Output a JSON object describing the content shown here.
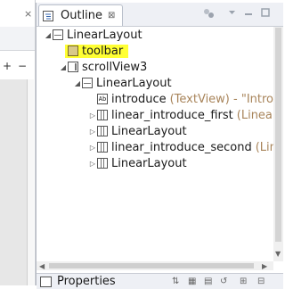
{
  "left_panel": {
    "tab_close": "×",
    "zoom_in": "+",
    "zoom_out": "−"
  },
  "outline": {
    "tab_title": "Outline",
    "tab_close": "⊠",
    "toolbar_icons": [
      "tree-options-icon",
      "view-menu-icon",
      "minimize-icon",
      "maximize-icon"
    ]
  },
  "tree": [
    {
      "label": "LinearLayout",
      "type": "",
      "expanded": true,
      "icon": "layout-icon",
      "selected": false
    },
    {
      "label": "toolbar",
      "type": "",
      "expanded": null,
      "icon": "toolbar-icon",
      "selected": true
    },
    {
      "label": "scrollView3",
      "type": "",
      "expanded": true,
      "icon": "scrollview-icon",
      "selected": false
    },
    {
      "label": "LinearLayout",
      "type": "",
      "expanded": true,
      "icon": "layout-icon",
      "selected": false
    },
    {
      "label": "introduce",
      "type": "(TextView) - \"Introd",
      "expanded": null,
      "icon": "textview-icon",
      "selected": false
    },
    {
      "label": "linear_introduce_first",
      "type": "(LinearL",
      "expanded": false,
      "icon": "linearlayout-icon",
      "selected": false
    },
    {
      "label": "LinearLayout",
      "type": "",
      "expanded": false,
      "icon": "linearlayout-icon",
      "selected": false
    },
    {
      "label": "linear_introduce_second",
      "type": "(Line",
      "expanded": false,
      "icon": "linearlayout-icon",
      "selected": false
    },
    {
      "label": "LinearLayout",
      "type": "",
      "expanded": false,
      "icon": "linearlayout-icon",
      "selected": false
    }
  ],
  "properties": {
    "title": "Properties"
  },
  "colors": {
    "selection": "#ffff33",
    "type_text": "#a8845a"
  }
}
